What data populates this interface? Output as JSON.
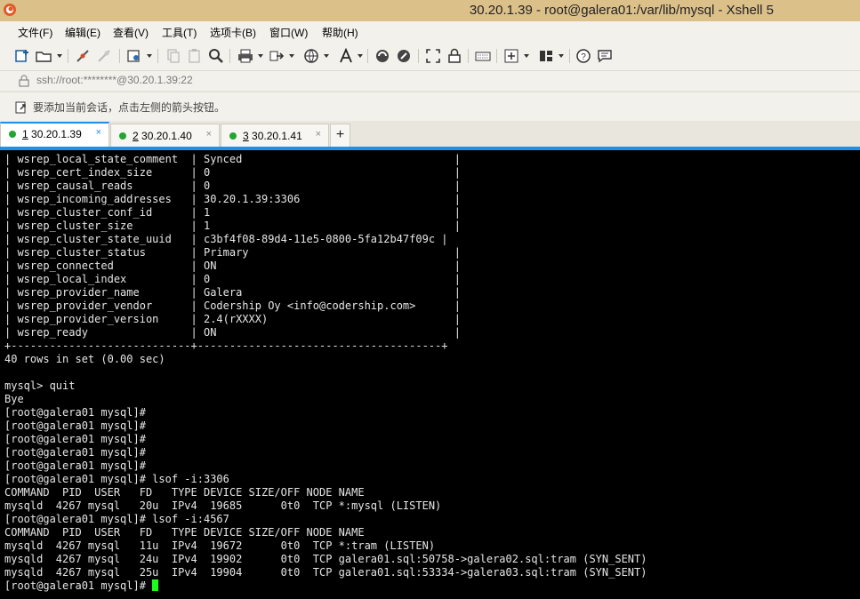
{
  "window": {
    "title": "30.20.1.39 - root@galera01:/var/lib/mysql - Xshell 5"
  },
  "menu": {
    "items": [
      {
        "label": "文件(F)"
      },
      {
        "label": "编辑(E)"
      },
      {
        "label": "查看(V)"
      },
      {
        "label": "工具(T)"
      },
      {
        "label": "选项卡(B)"
      },
      {
        "label": "窗口(W)"
      },
      {
        "label": "帮助(H)"
      }
    ]
  },
  "toolbar": {
    "icons": [
      "new-session-icon",
      "open-folder-icon",
      "disconnect-icon",
      "reconnect-icon",
      "properties-icon",
      "copy-icon",
      "paste-icon",
      "find-icon",
      "print-icon",
      "transfer-icon",
      "globe-icon",
      "font-icon",
      "xftp-icon",
      "xmanager-icon",
      "fullscreen-icon",
      "lock-icon",
      "keyboard-icon",
      "add-icon",
      "layout-icon",
      "help-icon",
      "chat-icon"
    ]
  },
  "address": {
    "value": "ssh://root:********@30.20.1.39:22"
  },
  "hint": {
    "text": "要添加当前会话，点击左侧的箭头按钮。"
  },
  "tabs": [
    {
      "number": "1",
      "label": "30.20.1.39",
      "active": true
    },
    {
      "number": "2",
      "label": "30.20.1.40",
      "active": false
    },
    {
      "number": "3",
      "label": "30.20.1.41",
      "active": false
    }
  ],
  "tab_close_glyph": "×",
  "add_tab_glyph": "+",
  "colors": {
    "tab_active_accent": "#1f90e8",
    "status_dot": "#22a531",
    "cursor": "#1aff1a",
    "titlebar": "#dcc08a"
  },
  "terminal": {
    "lines": [
      "| wsrep_local_state_comment  | Synced                                 |",
      "| wsrep_cert_index_size      | 0                                      |",
      "| wsrep_causal_reads         | 0                                      |",
      "| wsrep_incoming_addresses   | 30.20.1.39:3306                        |",
      "| wsrep_cluster_conf_id      | 1                                      |",
      "| wsrep_cluster_size         | 1                                      |",
      "| wsrep_cluster_state_uuid   | c3bf4f08-89d4-11e5-0800-5fa12b47f09c |",
      "| wsrep_cluster_status       | Primary                                |",
      "| wsrep_connected            | ON                                     |",
      "| wsrep_local_index          | 0                                      |",
      "| wsrep_provider_name        | Galera                                 |",
      "| wsrep_provider_vendor      | Codership Oy <info@codership.com>      |",
      "| wsrep_provider_version     | 2.4(rXXXX)                             |",
      "| wsrep_ready                | ON                                     |",
      "+----------------------------+--------------------------------------+",
      "40 rows in set (0.00 sec)",
      "",
      "mysql> quit",
      "Bye",
      "[root@galera01 mysql]#",
      "[root@galera01 mysql]#",
      "[root@galera01 mysql]#",
      "[root@galera01 mysql]#",
      "[root@galera01 mysql]#",
      "[root@galera01 mysql]# lsof -i:3306",
      "COMMAND  PID  USER   FD   TYPE DEVICE SIZE/OFF NODE NAME",
      "mysqld  4267 mysql   20u  IPv4  19685      0t0  TCP *:mysql (LISTEN)",
      "[root@galera01 mysql]# lsof -i:4567",
      "COMMAND  PID  USER   FD   TYPE DEVICE SIZE/OFF NODE NAME",
      "mysqld  4267 mysql   11u  IPv4  19672      0t0  TCP *:tram (LISTEN)",
      "mysqld  4267 mysql   24u  IPv4  19902      0t0  TCP galera01.sql:50758->galera02.sql:tram (SYN_SENT)",
      "mysqld  4267 mysql   25u  IPv4  19904      0t0  TCP galera01.sql:53334->galera03.sql:tram (SYN_SENT)"
    ],
    "prompt": "[root@galera01 mysql]# "
  }
}
